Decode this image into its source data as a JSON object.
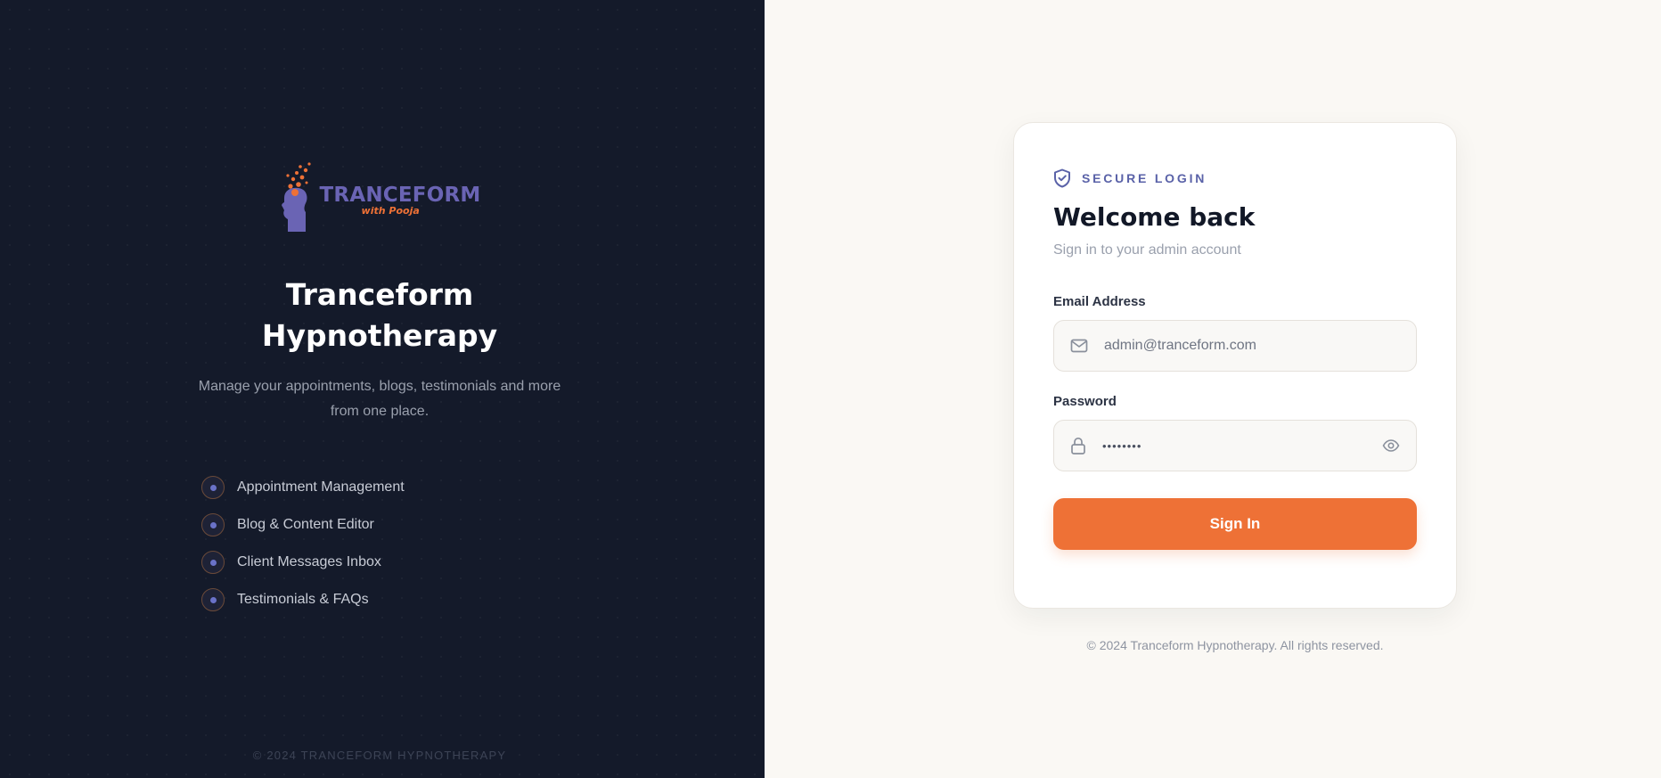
{
  "brand": {
    "logo_word": "TRANCEFORM",
    "logo_sub": "with Pooja",
    "title": "Tranceform Hypnotherapy",
    "subtitle": "Manage your appointments, blogs, testimonials and more from one place."
  },
  "features": [
    {
      "label": "Appointment Management"
    },
    {
      "label": "Blog & Content Editor"
    },
    {
      "label": "Client Messages Inbox"
    },
    {
      "label": "Testimonials & FAQs"
    }
  ],
  "left_footer": "© 2024 TRANCEFORM HYPNOTHERAPY",
  "login": {
    "badge": "SECURE LOGIN",
    "heading": "Welcome back",
    "hint": "Sign in to your admin account",
    "email_label": "Email Address",
    "email_value": "admin@tranceform.com",
    "password_label": "Password",
    "password_value": "••••••••",
    "submit_label": "Sign In"
  },
  "right_footer": "© 2024 Tranceform Hypnotherapy. All rights reserved.",
  "colors": {
    "accent": "#ee7136",
    "brand_purple": "#6a64b4",
    "panel_dark": "#141a2a",
    "page_bg": "#faf8f4"
  },
  "icons": [
    "shield-check-icon",
    "mail-icon",
    "lock-icon",
    "eye-icon",
    "feature-dot-icon",
    "head-butterflies-logo-icon"
  ]
}
